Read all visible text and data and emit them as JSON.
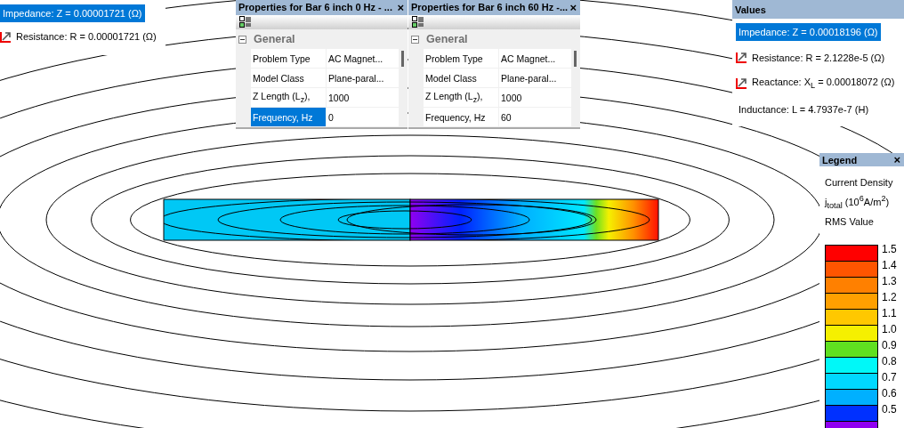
{
  "result_panel": {
    "rows": [
      {
        "kind": "plain",
        "text": "Impedance: Z = 0.00001721 (Ω)",
        "selected": true
      },
      {
        "kind": "resistance",
        "text": "Resistance: R = 0.00001721 (Ω)",
        "selected": false
      }
    ]
  },
  "property_windows": [
    {
      "title": "Properties for Bar 6 inch 0 Hz - ...",
      "close": "×",
      "group": {
        "label": "General",
        "expanded": true
      },
      "rows": [
        {
          "label": "Problem Type",
          "value": "AC Magnet...",
          "selected": false
        },
        {
          "label": "Model Class",
          "value": "Plane-paral...",
          "selected": false
        },
        {
          "label": "Z Length (L$_{z}$),",
          "value": "1000",
          "selected": false
        },
        {
          "label": "Frequency, Hz",
          "value": "0",
          "selected": true
        }
      ]
    },
    {
      "title": "Properties for Bar 6 inch 60 Hz -...",
      "close": "×",
      "group": {
        "label": "General",
        "expanded": true
      },
      "rows": [
        {
          "label": "Problem Type",
          "value": "AC Magnet...",
          "selected": false
        },
        {
          "label": "Model Class",
          "value": "Plane-paral...",
          "selected": false
        },
        {
          "label": "Z Length (L$_{z}$),",
          "value": "1000",
          "selected": false
        },
        {
          "label": "Frequency, Hz",
          "value": "60",
          "selected": false
        }
      ]
    }
  ],
  "values_window": {
    "title": "Values",
    "rows": [
      {
        "kind": "plain",
        "text": "Impedance: Z = 0.00018196 (Ω)",
        "selected": true
      },
      {
        "kind": "resistance",
        "text": "Resistance: R = 2.1228e-5 (Ω)",
        "selected": false
      },
      {
        "kind": "reactance",
        "text": "Reactance: X$_{L}$ = 0.00018072 (Ω)",
        "selected": false
      },
      {
        "kind": "plain",
        "text": "Inductance: L = 4.7937e-7 (H)",
        "selected": false
      }
    ]
  },
  "legend": {
    "title": "Legend",
    "close": "×",
    "lines": [
      "Current Density",
      "j$_{total}$ (10$^{6}$A/m$^{2}$)",
      "RMS Value"
    ],
    "bands": [
      {
        "color": "#ff0000"
      },
      {
        "color": "#ff5500"
      },
      {
        "color": "#ff8000"
      },
      {
        "color": "#ffa000"
      },
      {
        "color": "#ffc800"
      },
      {
        "color": "#f5f000"
      },
      {
        "color": "#60e020"
      },
      {
        "color": "#00f8f8"
      },
      {
        "color": "#00d8ff"
      },
      {
        "color": "#00b0ff"
      },
      {
        "color": "#0030ff"
      },
      {
        "color": "#9000f0"
      }
    ],
    "ticks": [
      "1.5",
      "1.4",
      "1.3",
      "1.2",
      "1.1",
      "1.0",
      "0.9",
      "0.8",
      "0.7",
      "0.6",
      "0.5"
    ]
  }
}
